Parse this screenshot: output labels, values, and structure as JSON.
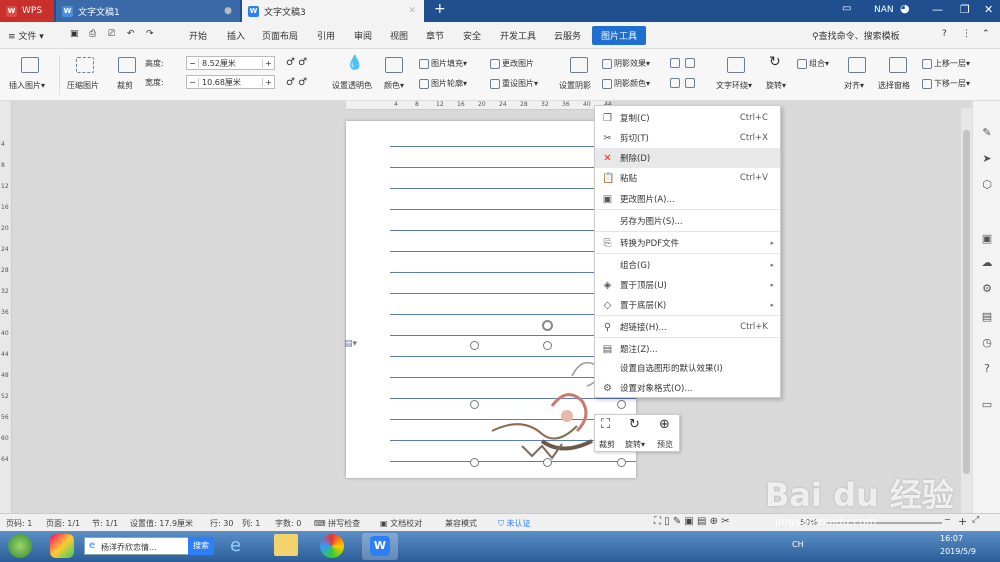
{
  "tabs": [
    {
      "label": "WPS"
    },
    {
      "label": "文字文稿1"
    },
    {
      "label": "文字文稿3"
    }
  ],
  "title_right": {
    "user": "NAN"
  },
  "menu": {
    "file": "文件",
    "items": [
      "开始",
      "插入",
      "页面布局",
      "引用",
      "审阅",
      "视图",
      "章节",
      "安全",
      "开发工具",
      "云服务"
    ],
    "active": "图片工具",
    "search": "查找命令、搜索模板"
  },
  "ribbon": {
    "insert_pic": "插入图片",
    "compress": "压缩图片",
    "crop": "裁剪",
    "height_label": "高度:",
    "height_value": "8.52厘米",
    "width_label": "宽度:",
    "width_value": "10.68厘米",
    "transparent": "设置透明色",
    "color": "颜色",
    "fill": "图片填充",
    "outline": "图片轮廓",
    "change_pic": "更改图片",
    "reset_pic": "重设图片",
    "shadow": "设置阴影",
    "shadow_effect": "阴影效果",
    "shadow_color": "阴影颜色",
    "wrap": "文字环绕",
    "rotate": "旋转",
    "group": "组合",
    "align": "对齐",
    "selection_pane": "选择窗格",
    "bring_forward": "上移一层",
    "send_backward": "下移一层"
  },
  "ruler_top": [
    "4",
    "8",
    "12",
    "16",
    "20",
    "24",
    "28",
    "32",
    "36",
    "40",
    "44"
  ],
  "ruler_left": [
    "4",
    "8",
    "12",
    "16",
    "20",
    "24",
    "28",
    "32",
    "36",
    "40",
    "44",
    "48",
    "52",
    "56",
    "60",
    "64"
  ],
  "context_menu": [
    {
      "icon": "copy-icon",
      "glyph": "❐",
      "label": "复制(C)",
      "shortcut": "Ctrl+C"
    },
    {
      "icon": "cut-icon",
      "glyph": "✂",
      "label": "剪切(T)",
      "shortcut": "Ctrl+X"
    },
    {
      "icon": "delete-icon",
      "glyph": "✕",
      "label": "删除(D)",
      "shortcut": ""
    },
    {
      "icon": "paste-icon",
      "glyph": "📋",
      "label": "粘贴",
      "shortcut": "Ctrl+V"
    },
    {
      "icon": "change-picture-icon",
      "glyph": "▣",
      "label": "更改图片(A)...",
      "shortcut": ""
    },
    {
      "icon": "",
      "glyph": "",
      "label": "另存为图片(S)...",
      "shortcut": ""
    },
    {
      "icon": "pdf-icon",
      "glyph": "⎘",
      "label": "转换为PDF文件",
      "shortcut": "",
      "arrow": true
    },
    {
      "icon": "",
      "glyph": "",
      "label": "组合(G)",
      "shortcut": "",
      "arrow": true
    },
    {
      "icon": "bring-front-icon",
      "glyph": "◈",
      "label": "置于顶层(U)",
      "shortcut": "",
      "arrow": true
    },
    {
      "icon": "send-back-icon",
      "glyph": "◇",
      "label": "置于底层(K)",
      "shortcut": "",
      "arrow": true
    },
    {
      "icon": "hyperlink-icon",
      "glyph": "⚲",
      "label": "超链接(H)...",
      "shortcut": "Ctrl+K"
    },
    {
      "icon": "caption-icon",
      "glyph": "▤",
      "label": "题注(Z)...",
      "shortcut": ""
    },
    {
      "icon": "",
      "glyph": "",
      "label": "设置自选图形的默认效果(I)",
      "shortcut": ""
    },
    {
      "icon": "format-object-icon",
      "glyph": "⚙",
      "label": "设置对象格式(O)...",
      "shortcut": ""
    }
  ],
  "mini_toolbar": {
    "crop": "裁剪",
    "rotate": "旋转",
    "preview": "预览"
  },
  "status": {
    "page_num": "页码: 1",
    "pages": "页面: 1/1",
    "section": "节: 1/1",
    "set_value": "设置值: 17.9厘米",
    "row": "行: 30",
    "col": "列: 1",
    "chars": "字数: 0",
    "spell": "拼写检查",
    "proof": "文档校对",
    "compat": "兼容模式",
    "auth": "未认证",
    "zoom": "50%"
  },
  "taskbar": {
    "task1": "杨洋乔欣恋情...",
    "search": "搜索",
    "clock_time": "16:07",
    "clock_date": "2019/5/9",
    "lang": "CH"
  },
  "watermark": {
    "text": "Bai du 经验",
    "url": "jingyan.baidu.com"
  }
}
